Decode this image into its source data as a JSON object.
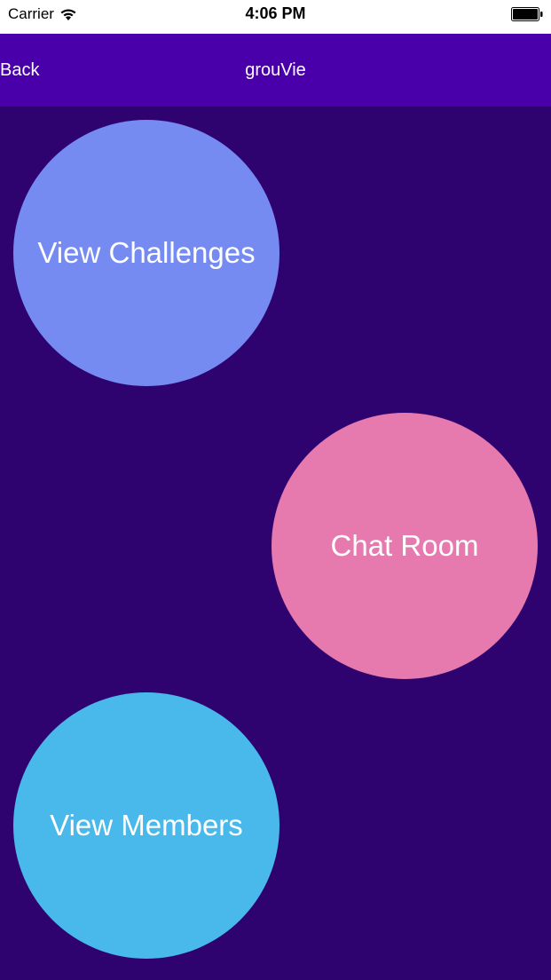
{
  "status_bar": {
    "carrier": "Carrier",
    "time": "4:06 PM",
    "wifi_icon": "wifi-icon",
    "battery_icon": "battery-full-icon"
  },
  "nav_bar": {
    "back_label": "Back",
    "title": "grouVie",
    "background_color": "#4900aa"
  },
  "main": {
    "background_color": "#2f036f",
    "buttons": [
      {
        "label": "View Challenges",
        "color": "#758bf2"
      },
      {
        "label": "Chat Room",
        "color": "#e67aae"
      },
      {
        "label": "View Members",
        "color": "#48b9ea"
      }
    ]
  }
}
